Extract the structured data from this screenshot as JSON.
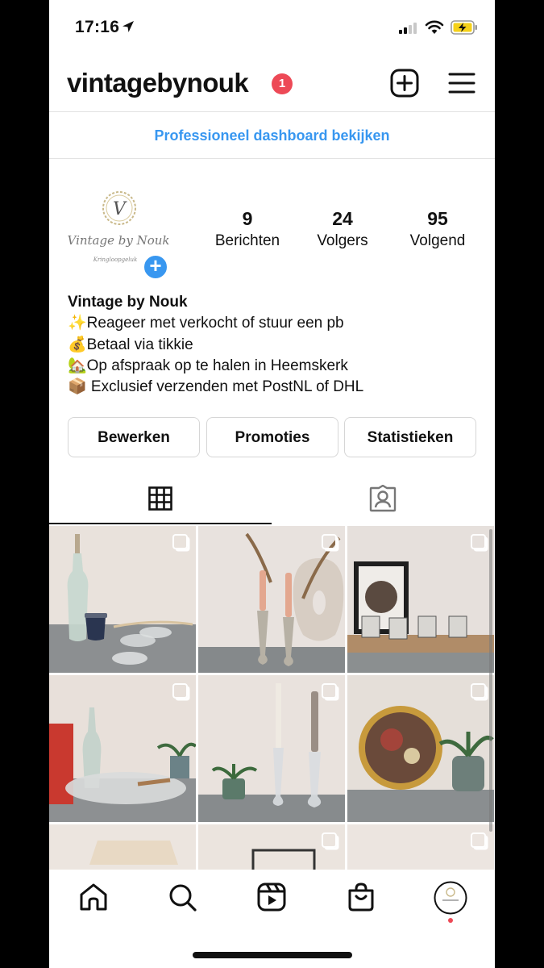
{
  "status_bar": {
    "time": "17:16",
    "location_icon": "location-arrow-icon",
    "signal_icon": "cellular-signal-icon",
    "wifi_icon": "wifi-icon",
    "battery_icon": "battery-charging-icon",
    "battery_color": "#f5d11a"
  },
  "header": {
    "username": "vintagebynouk",
    "notification_count": "1",
    "notification_color": "#ed4956",
    "add_icon": "new-post-icon",
    "menu_icon": "hamburger-menu-icon"
  },
  "dashboard_link": "Professioneel dashboard bekijken",
  "accent_color": "#3897f0",
  "profile": {
    "avatar_logo_letter": "V",
    "avatar_logo_text": "Vintage by Nouk",
    "avatar_logo_sub": "Kringloopgeluk",
    "stats": [
      {
        "value": "9",
        "label": "Berichten"
      },
      {
        "value": "24",
        "label": "Volgers"
      },
      {
        "value": "95",
        "label": "Volgend"
      }
    ],
    "display_name": "Vintage by Nouk",
    "bio_lines": [
      "✨Reageer met verkocht of stuur een pb",
      "💰Betaal via tikkie",
      "🏡Op afspraak op te halen in Heemskerk",
      "📦 Exclusief verzenden met PostNL of DHL"
    ]
  },
  "actions": [
    "Bewerken",
    "Promoties",
    "Statistieken"
  ],
  "tabs": [
    {
      "icon": "grid-icon",
      "active": true
    },
    {
      "icon": "tagged-person-icon",
      "active": false
    }
  ],
  "posts": [
    {
      "subject": "glass bottle, blue cups and glass coasters",
      "multi": true
    },
    {
      "subject": "brass candlesticks with pink candles and dried grass",
      "multi": true
    },
    {
      "subject": "framed art and patterned cups on wooden tray",
      "multi": true
    },
    {
      "subject": "glass bowl, bottle, book and plant",
      "multi": true
    },
    {
      "subject": "glass candlesticks and small plants",
      "multi": true
    },
    {
      "subject": "decorative plate and plant in pot",
      "multi": true
    },
    {
      "subject": "lamp shade",
      "multi": false
    },
    {
      "subject": "picture frame",
      "multi": true
    },
    {
      "subject": "wall",
      "multi": true
    }
  ],
  "bottom_nav": [
    {
      "icon": "home-icon"
    },
    {
      "icon": "search-icon"
    },
    {
      "icon": "reels-icon"
    },
    {
      "icon": "shop-bag-icon"
    },
    {
      "icon": "profile-avatar-icon"
    }
  ]
}
